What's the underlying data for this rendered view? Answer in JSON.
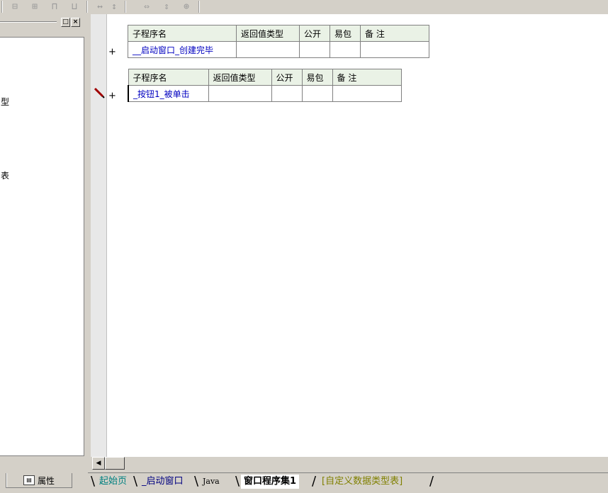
{
  "left_panel": {
    "tree_fragments": [
      "型",
      "表"
    ]
  },
  "left_tab": {
    "label": "属性"
  },
  "tables": [
    {
      "headers": [
        "子程序名",
        "返回值类型",
        "公开",
        "易包",
        "备 注"
      ],
      "row": [
        "__启动窗口_创建完毕",
        "",
        "",
        "",
        ""
      ]
    },
    {
      "headers": [
        "子程序名",
        "返回值类型",
        "公开",
        "易包",
        "备 注"
      ],
      "row": [
        "_按钮1_被单击",
        "",
        "",
        "",
        ""
      ]
    }
  ],
  "gutter_marks": [
    "+",
    "+"
  ],
  "bottom_tabs": [
    {
      "label": "起始页",
      "color": "#008080",
      "active": false
    },
    {
      "label": "_启动窗口",
      "color": "#000080",
      "active": false
    },
    {
      "label": "Java",
      "color": "#000000",
      "active": false
    },
    {
      "label": "窗口程序集1",
      "color": "#000000",
      "active": true
    },
    {
      "label": "[自定义数据类型表]",
      "color": "#808000",
      "active": false
    }
  ]
}
